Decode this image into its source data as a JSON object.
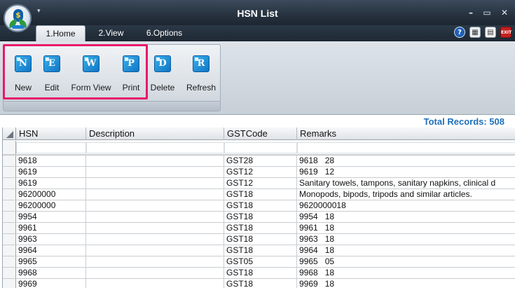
{
  "window": {
    "title": "HSN List",
    "logo_letter": "$",
    "qa_arrow": "▾",
    "minimize": "–",
    "maximize": "▭",
    "close": "✕"
  },
  "tabs": [
    {
      "label": "1.Home",
      "active": true
    },
    {
      "label": "2.View",
      "active": false
    },
    {
      "label": "6.Options",
      "active": false
    }
  ],
  "toolbar_icons": {
    "help": "?",
    "calculator": "▦",
    "notepad": "▤",
    "exit": "EXIT"
  },
  "ribbon": {
    "buttons": [
      {
        "label": "New",
        "glyph": "N"
      },
      {
        "label": "Edit",
        "glyph": "E"
      },
      {
        "label": "Form View",
        "glyph": "W"
      },
      {
        "label": "Print",
        "glyph": "P"
      },
      {
        "label": "Delete",
        "glyph": "D"
      },
      {
        "label": "Refresh",
        "glyph": "R"
      }
    ]
  },
  "status": {
    "total_records": "Total Records: 508"
  },
  "grid": {
    "columns": [
      "HSN",
      "Description",
      "GSTCode",
      "Remarks"
    ],
    "rows": [
      {
        "hsn": "9618",
        "desc": "",
        "gst": "GST28",
        "remarks": "9618   28"
      },
      {
        "hsn": "9619",
        "desc": "",
        "gst": "GST12",
        "remarks": "9619   12"
      },
      {
        "hsn": "9619",
        "desc": "",
        "gst": "GST12",
        "remarks": "Sanitary towels, tampons, sanitary napkins, clinical d"
      },
      {
        "hsn": "96200000",
        "desc": "",
        "gst": "GST18",
        "remarks": "Monopods, bipods, tripods and similar articles."
      },
      {
        "hsn": "96200000",
        "desc": "",
        "gst": "GST18",
        "remarks": "9620000018"
      },
      {
        "hsn": "9954",
        "desc": "",
        "gst": "GST18",
        "remarks": "9954   18"
      },
      {
        "hsn": "9961",
        "desc": "",
        "gst": "GST18",
        "remarks": "9961   18"
      },
      {
        "hsn": "9963",
        "desc": "",
        "gst": "GST18",
        "remarks": "9963   18"
      },
      {
        "hsn": "9964",
        "desc": "",
        "gst": "GST18",
        "remarks": "9964   18"
      },
      {
        "hsn": "9965",
        "desc": "",
        "gst": "GST05",
        "remarks": "9965   05"
      },
      {
        "hsn": "9968",
        "desc": "",
        "gst": "GST18",
        "remarks": "9968   18"
      },
      {
        "hsn": "9969",
        "desc": "",
        "gst": "GST18",
        "remarks": "9969   18"
      }
    ]
  },
  "colors": {
    "highlight": "#e8196a",
    "accent_blue": "#1f6fb8",
    "titlebar": "#26323f"
  }
}
